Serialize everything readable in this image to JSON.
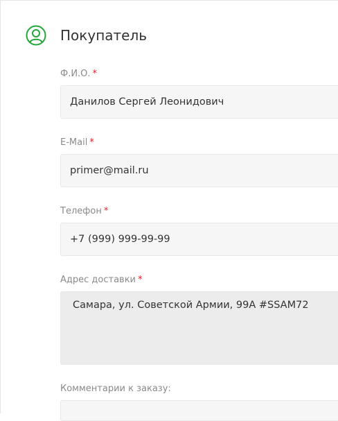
{
  "section": {
    "title": "Покупатель",
    "icon": "user-circle-icon",
    "accent_color": "#22a63a"
  },
  "fields": {
    "fio": {
      "label": "Ф.И.О.",
      "required_mark": "*",
      "value": "Данилов Сергей Леонидович"
    },
    "email": {
      "label": "E-Mail",
      "required_mark": "*",
      "value": "primer@mail.ru"
    },
    "phone": {
      "label": "Телефон",
      "required_mark": "*",
      "value": "+7 (999) 999-99-99"
    },
    "address": {
      "label": "Адрес доставки",
      "required_mark": "*",
      "value": "Самара, ул. Советской Армии, 99А #SSAM72"
    },
    "comment": {
      "label": "Комментарии к заказу:",
      "value": ""
    }
  }
}
